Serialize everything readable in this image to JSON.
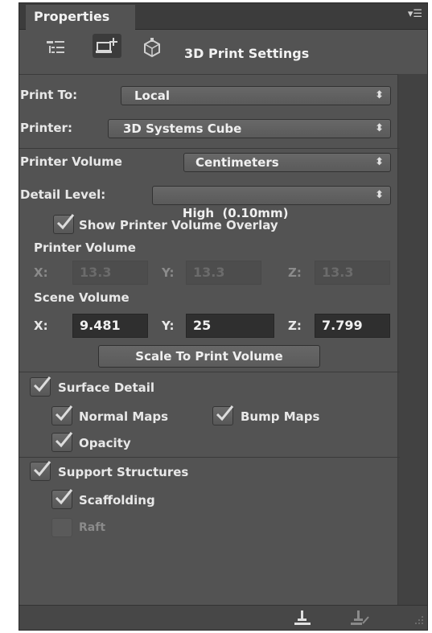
{
  "panel": {
    "tab_label": "Properties",
    "title": "3D Print Settings"
  },
  "print_to": {
    "label": "Print To:",
    "value": "Local"
  },
  "printer": {
    "label": "Printer:",
    "value": "3D Systems Cube"
  },
  "printer_volume_units": {
    "label": "Printer Volume",
    "value": "Centimeters"
  },
  "detail_level": {
    "label": "Detail Level:",
    "value": "High  (0.10mm)"
  },
  "show_overlay": {
    "label": "Show Printer Volume Overlay",
    "checked": true
  },
  "printer_volume": {
    "heading": "Printer Volume",
    "x_label": "X:",
    "x": "13.3",
    "y_label": "Y:",
    "y": "13.3",
    "z_label": "Z:",
    "z": "13.3"
  },
  "scene_volume": {
    "heading": "Scene Volume",
    "x_label": "X:",
    "x": "9.481",
    "y_label": "Y:",
    "y": "25",
    "z_label": "Z:",
    "z": "7.799"
  },
  "scale_button": "Scale To Print Volume",
  "surface_detail": {
    "label": "Surface Detail",
    "checked": true,
    "normal_maps": "Normal Maps",
    "bump_maps": "Bump Maps",
    "opacity": "Opacity"
  },
  "support_structures": {
    "label": "Support Structures",
    "checked": true,
    "scaffolding": "Scaffolding",
    "raft": "Raft"
  }
}
